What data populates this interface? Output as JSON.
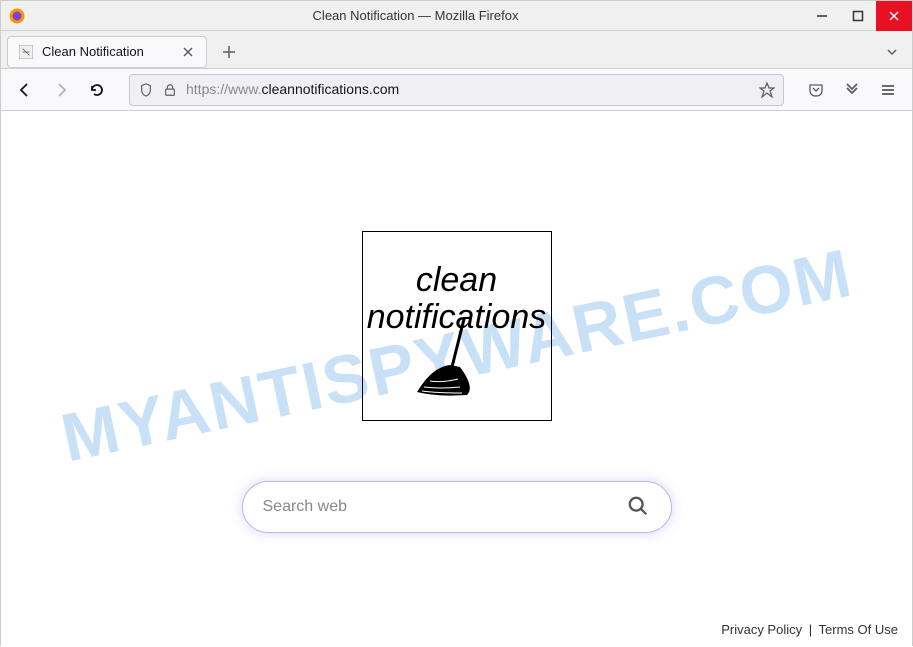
{
  "window": {
    "title": "Clean Notification — Mozilla Firefox"
  },
  "tab": {
    "title": "Clean Notification"
  },
  "url": {
    "scheme": "https://www.",
    "host": "cleannotifications.com"
  },
  "logo": {
    "line1": "clean",
    "line2": "notifications"
  },
  "search": {
    "placeholder": "Search web"
  },
  "footer": {
    "privacy": "Privacy Policy",
    "terms": "Terms Of Use",
    "separator": "|"
  },
  "watermark": "MYANTISPYWARE.COM"
}
